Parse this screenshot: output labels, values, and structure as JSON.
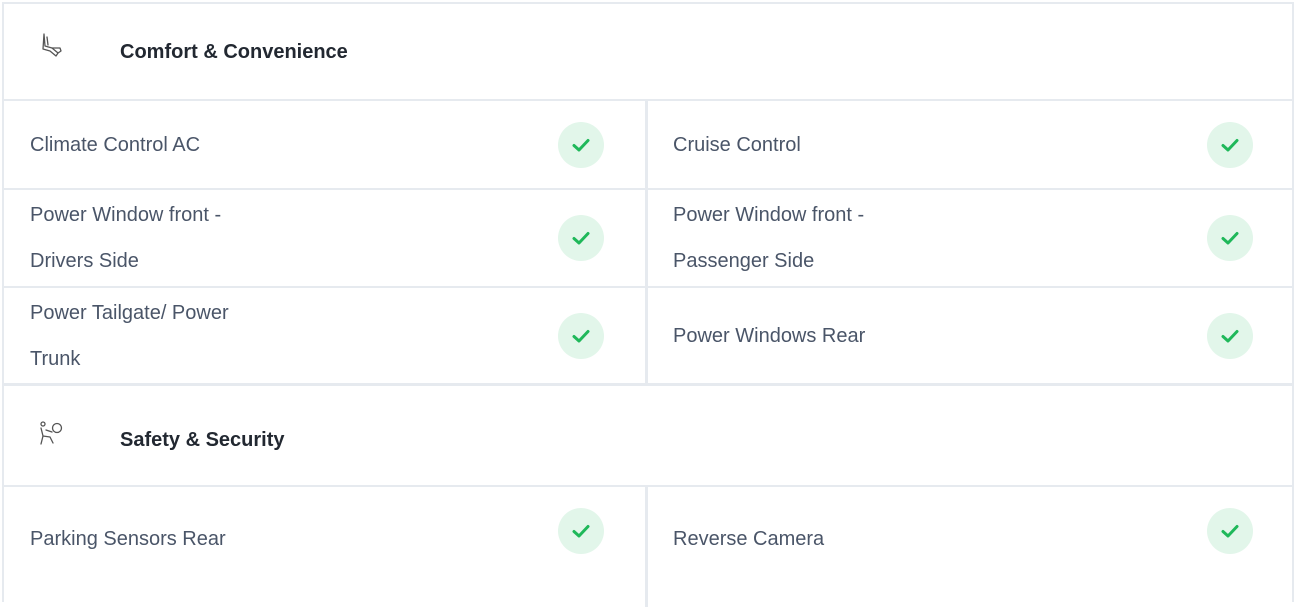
{
  "sections": [
    {
      "title": "Comfort & Convenience",
      "icon": "seat-icon",
      "rows": [
        {
          "left": "Climate Control AC",
          "right": "Cruise Control"
        },
        {
          "left": "Power Window front -\nDrivers Side",
          "right": "Power Window front -\nPassenger Side"
        },
        {
          "left": "Power Tailgate/ Power\nTrunk",
          "right": "Power Windows Rear"
        }
      ]
    },
    {
      "title": "Safety & Security",
      "icon": "airbag-icon",
      "rows": [
        {
          "left": "Parking Sensors Rear",
          "right": "Reverse Camera"
        }
      ]
    }
  ],
  "colors": {
    "check_green": "#1fb85a",
    "check_bg": "#e2f6ea",
    "border": "#e6eaef"
  }
}
